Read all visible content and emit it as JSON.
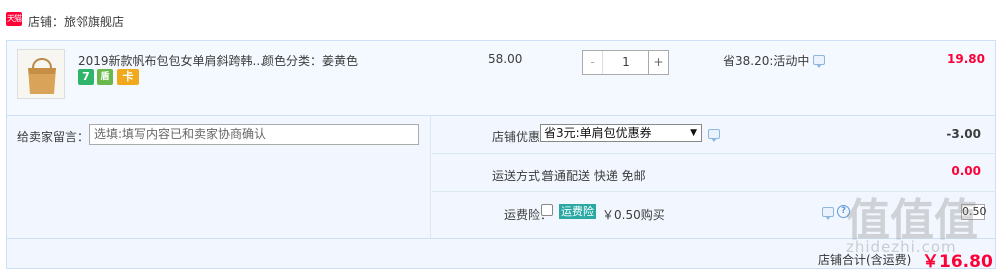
{
  "shop": {
    "icon_text": "天猫",
    "name": "店铺：旅邻旗舰店"
  },
  "item": {
    "title": "2019新款帆布包包女单肩斜跨韩...",
    "sku": "颜色分类：姜黄色",
    "badges": [
      "7",
      "盾",
      "卡"
    ],
    "unit_price": "58.00",
    "quantity": {
      "minus": "-",
      "value": "1",
      "plus": "+"
    },
    "saving": "省38.20:活动中",
    "total": "19.80"
  },
  "message": {
    "label": "给卖家留言：",
    "placeholder": "选填:填写内容已和卖家协商确认"
  },
  "discount": {
    "label": "店铺优惠：",
    "selected": "省3元:单肩包优惠券",
    "amount": "-3.00"
  },
  "shipping": {
    "label": "运送方式：",
    "value": "普通配送 快递 免邮",
    "amount": "0.00"
  },
  "insurance": {
    "label": "运费险：",
    "badge": "运费险",
    "price": "￥0.50购买",
    "help": "?",
    "amount": "0.50"
  },
  "summary": {
    "label": "店铺合计(含运费)",
    "amount": "￥16.80"
  },
  "watermark": {
    "text": "值值值",
    "url": "zhidezhi.com"
  },
  "colors": {
    "accent_red": "#ff0036",
    "panel_blue": "#f4f9ff",
    "border_blue": "#cce0f7"
  }
}
